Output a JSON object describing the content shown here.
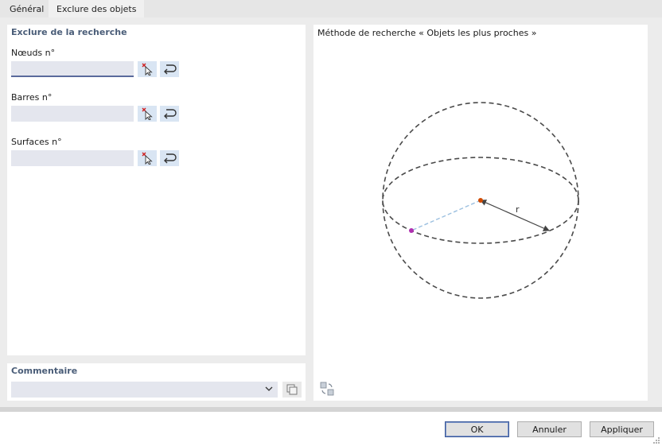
{
  "tabs": [
    {
      "label": "Général"
    },
    {
      "label": "Exclure des objets"
    }
  ],
  "exclude": {
    "title": "Exclure de la recherche",
    "fields": [
      {
        "label": "Nœuds n°",
        "value": ""
      },
      {
        "label": "Barres n°",
        "value": ""
      },
      {
        "label": "Surfaces n°",
        "value": ""
      }
    ]
  },
  "comment": {
    "title": "Commentaire",
    "value": ""
  },
  "diagram": {
    "title": "Méthode de recherche « Objets les plus proches »",
    "radius_label": "r",
    "colors": {
      "sphere": "#4a4a4a",
      "center_point": "#d04a00",
      "object_point": "#b030b0",
      "distance_line": "#9cc0e0",
      "radius_arrow": "#444444"
    }
  },
  "icons": {
    "select_clear": "cursor-x-icon",
    "select_reset": "return-arrow-icon",
    "copy": "copy-icon",
    "refresh": "refresh-icon",
    "chevron": "chevron-down-icon"
  },
  "buttons": {
    "ok": "OK",
    "cancel": "Annuler",
    "apply": "Appliquer"
  }
}
